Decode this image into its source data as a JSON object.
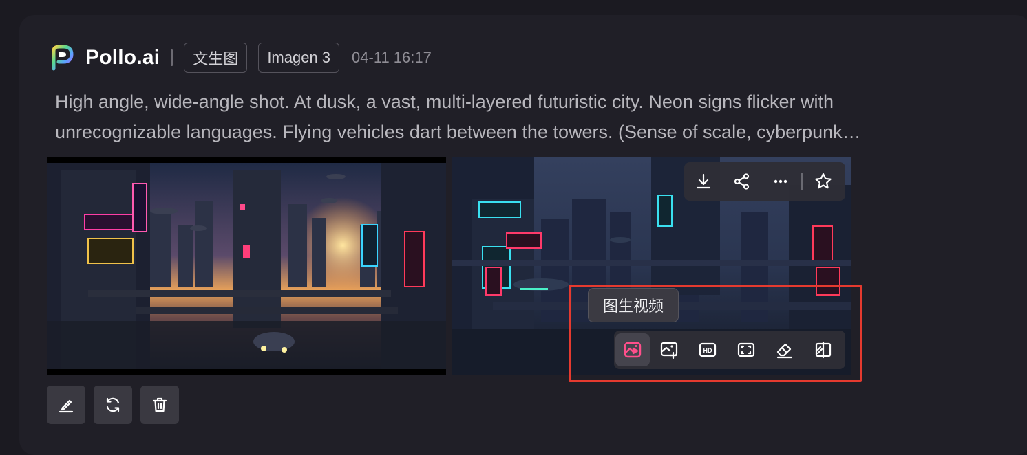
{
  "header": {
    "brand": "Pollo.ai",
    "tag_type": "文生图",
    "tag_model": "Imagen 3",
    "timestamp": "04-11 16:17"
  },
  "prompt_line1": "High angle, wide-angle shot. At dusk, a vast, multi-layered futuristic city. Neon signs flicker with",
  "prompt_line2": "unrecognizable languages. Flying vehicles dart between the towers. (Sense of scale, cyberpunk…",
  "image_toolbar": {
    "icons": [
      "download-icon",
      "share-icon",
      "more-icon",
      "star-icon"
    ]
  },
  "tooltip": "图生视频",
  "edit_toolbar": {
    "icons": [
      "image-to-video-icon",
      "image-to-image-icon",
      "hd-upscale-icon",
      "expand-icon",
      "eraser-icon",
      "remove-background-icon"
    ],
    "active_index": 0
  },
  "actions": {
    "icons": [
      "edit-icon",
      "regenerate-icon",
      "delete-icon"
    ]
  },
  "colors": {
    "background": "#1b1a21",
    "card": "#201f27",
    "highlight_box": "#e53a2f",
    "active_icon": "#ff4f8b"
  }
}
